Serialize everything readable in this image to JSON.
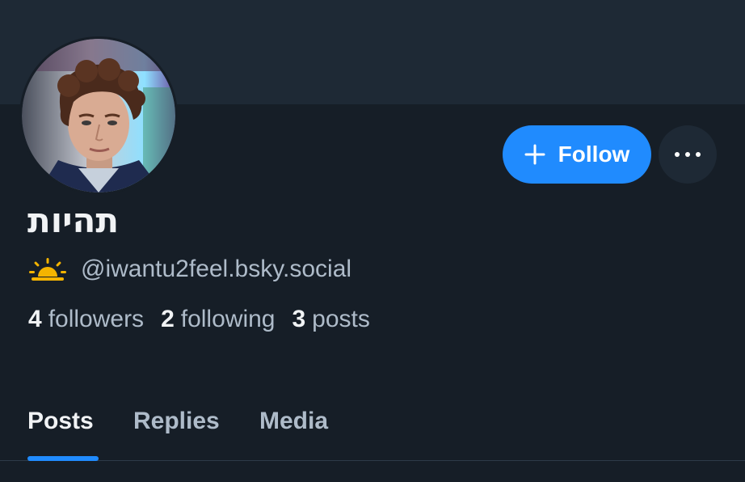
{
  "profile": {
    "display_name": "תהיות",
    "handle": "@iwantu2feel.bsky.social",
    "status_icon": "sunrise-icon"
  },
  "actions": {
    "follow_label": "Follow",
    "follow_icon": "plus-icon",
    "more_icon": "ellipsis-icon"
  },
  "stats": {
    "followers_count": "4",
    "followers_label": "followers",
    "following_count": "2",
    "following_label": "following",
    "posts_count": "3",
    "posts_label": "posts"
  },
  "tabs": [
    {
      "label": "Posts",
      "active": true
    },
    {
      "label": "Replies",
      "active": false
    },
    {
      "label": "Media",
      "active": false
    }
  ],
  "colors": {
    "background": "#161e27",
    "banner": "#1e2935",
    "accent": "#208bfe",
    "text_primary": "#f1f3f5",
    "text_secondary": "#aebbc9",
    "sunrise": "#f4b400"
  }
}
